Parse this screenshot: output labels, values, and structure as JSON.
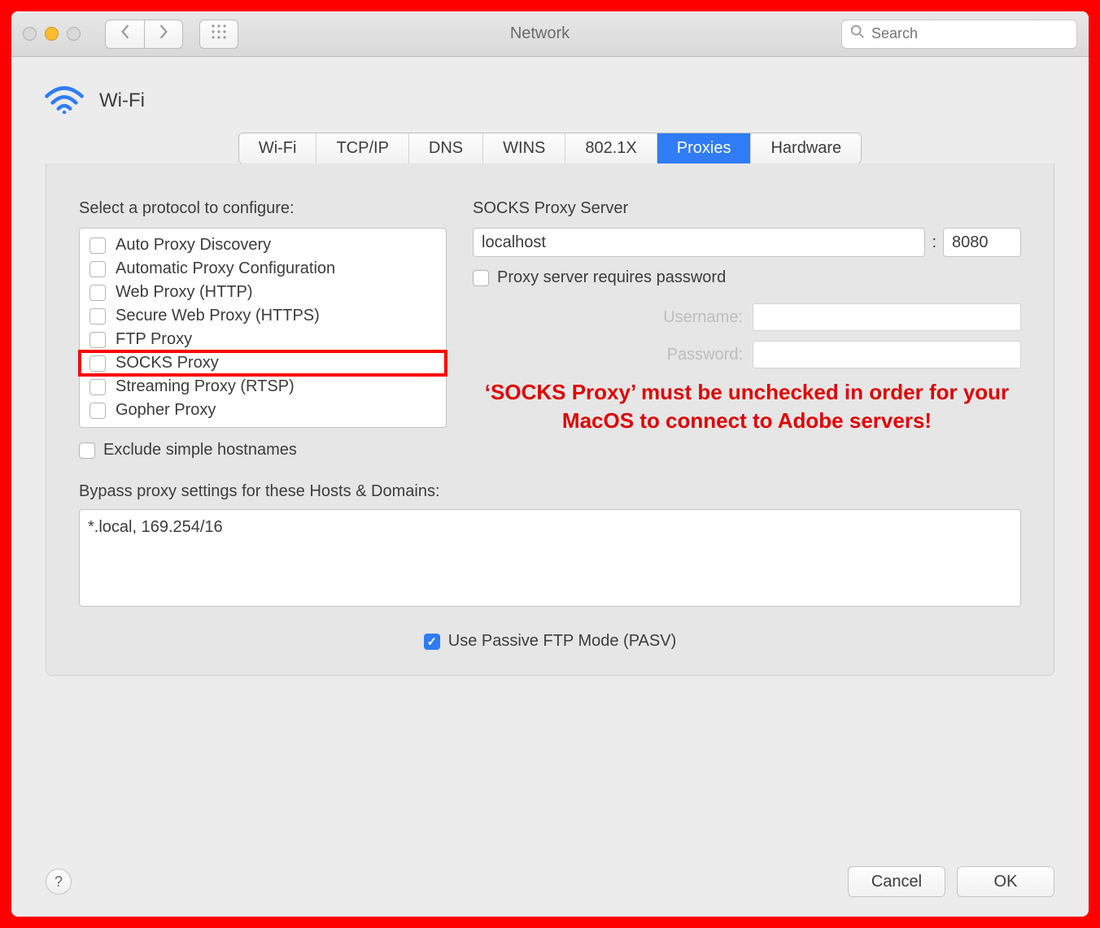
{
  "title": "Network",
  "search_placeholder": "Search",
  "header": {
    "title": "Wi-Fi"
  },
  "tabs": [
    {
      "label": "Wi-Fi"
    },
    {
      "label": "TCP/IP"
    },
    {
      "label": "DNS"
    },
    {
      "label": "WINS"
    },
    {
      "label": "802.1X"
    },
    {
      "label": "Proxies",
      "active": true
    },
    {
      "label": "Hardware"
    }
  ],
  "left": {
    "select_label": "Select a protocol to configure:",
    "protocols": [
      {
        "label": "Auto Proxy Discovery",
        "checked": false
      },
      {
        "label": "Automatic Proxy Configuration",
        "checked": false
      },
      {
        "label": "Web Proxy (HTTP)",
        "checked": false
      },
      {
        "label": "Secure Web Proxy (HTTPS)",
        "checked": false
      },
      {
        "label": "FTP Proxy",
        "checked": false
      },
      {
        "label": "SOCKS Proxy",
        "checked": false,
        "highlight": true
      },
      {
        "label": "Streaming Proxy (RTSP)",
        "checked": false
      },
      {
        "label": "Gopher Proxy",
        "checked": false
      }
    ],
    "exclude_label": "Exclude simple hostnames",
    "exclude_checked": false
  },
  "right": {
    "server_label": "SOCKS Proxy Server",
    "host": "localhost",
    "port": "8080",
    "pw_required_label": "Proxy server requires password",
    "pw_required_checked": false,
    "username_label": "Username:",
    "password_label": "Password:",
    "annotation": "‘SOCKS Proxy’ must be unchecked in order for your MacOS to connect to Adobe servers!"
  },
  "bypass_label": "Bypass proxy settings for these Hosts & Domains:",
  "bypass_value": "*.local, 169.254/16",
  "pasv_label": "Use Passive FTP Mode (PASV)",
  "pasv_checked": true,
  "footer": {
    "cancel": "Cancel",
    "ok": "OK"
  }
}
